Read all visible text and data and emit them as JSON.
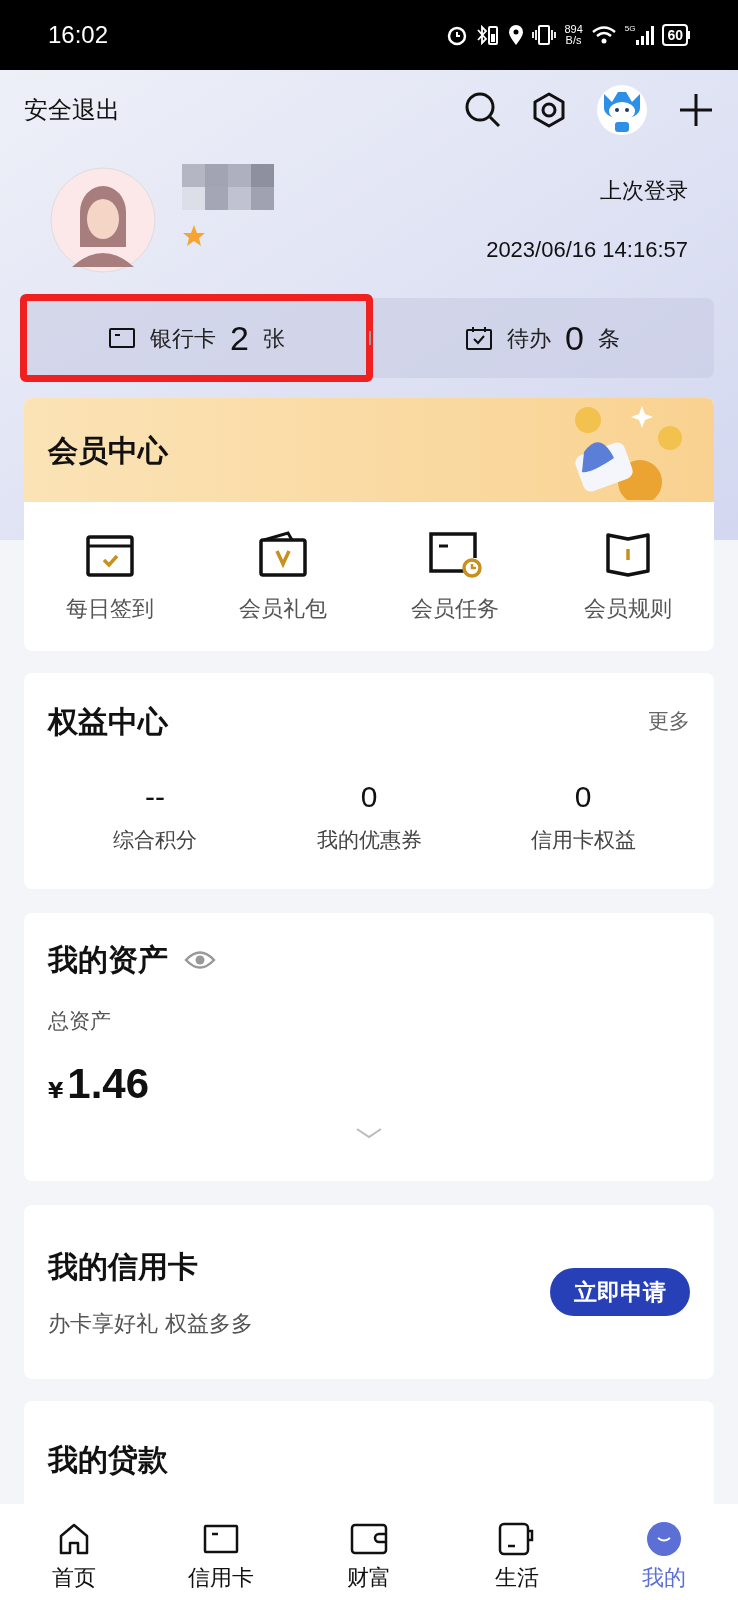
{
  "status_bar": {
    "time": "16:02",
    "speed_value": "894",
    "speed_unit": "B/s",
    "network": "5G",
    "battery": "60"
  },
  "header": {
    "exit": "安全退出"
  },
  "profile": {
    "last_login_label": "上次登录",
    "last_login_time": "2023/06/16 14:16:57"
  },
  "quick": [
    {
      "kind": "card",
      "label": "银行卡",
      "count": "2",
      "unit": "张",
      "highlighted": true
    },
    {
      "kind": "todo",
      "label": "待办",
      "count": "0",
      "unit": "条",
      "highlighted": false
    }
  ],
  "member": {
    "title": "会员中心",
    "items": [
      {
        "kind": "checkin",
        "label": "每日签到"
      },
      {
        "kind": "gift",
        "label": "会员礼包"
      },
      {
        "kind": "task",
        "label": "会员任务"
      },
      {
        "kind": "rules",
        "label": "会员规则"
      }
    ]
  },
  "benefits": {
    "title": "权益中心",
    "more": "更多",
    "stats": [
      {
        "value": "--",
        "label": "综合积分"
      },
      {
        "value": "0",
        "label": "我的优惠券"
      },
      {
        "value": "0",
        "label": "信用卡权益"
      }
    ]
  },
  "assets": {
    "title": "我的资产",
    "total_label": "总资产",
    "currency": "¥",
    "amount": "1.46"
  },
  "credit": {
    "title": "我的信用卡",
    "subtitle": "办卡享好礼 权益多多",
    "button": "立即申请"
  },
  "loans": {
    "title": "我的贷款"
  },
  "nav": [
    {
      "kind": "home",
      "label": "首页",
      "selected": false
    },
    {
      "kind": "card",
      "label": "信用卡",
      "selected": false
    },
    {
      "kind": "wallet",
      "label": "财富",
      "selected": false
    },
    {
      "kind": "cup",
      "label": "生活",
      "selected": false
    },
    {
      "kind": "me",
      "label": "我的",
      "selected": true
    }
  ]
}
